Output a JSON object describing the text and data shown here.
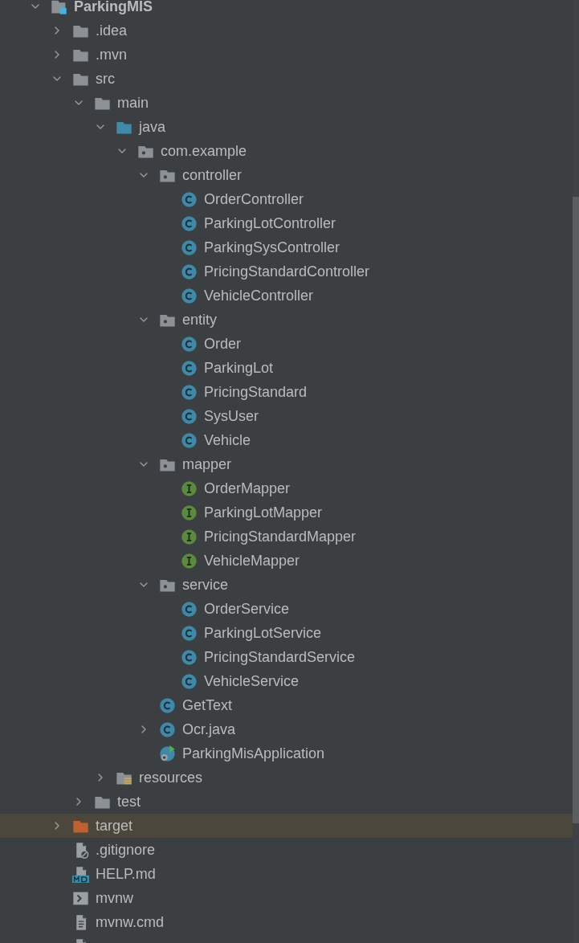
{
  "tree": [
    {
      "label": "ParkingMIS",
      "kind": "project",
      "expanded": true,
      "selected": false,
      "children": [
        {
          "label": ".idea",
          "kind": "folder",
          "expanded": false,
          "selected": false
        },
        {
          "label": ".mvn",
          "kind": "folder",
          "expanded": false,
          "selected": false
        },
        {
          "label": "src",
          "kind": "folder",
          "expanded": true,
          "selected": false,
          "children": [
            {
              "label": "main",
              "kind": "folder",
              "expanded": true,
              "selected": false,
              "children": [
                {
                  "label": "java",
                  "kind": "source-folder",
                  "expanded": true,
                  "selected": false,
                  "children": [
                    {
                      "label": "com.example",
                      "kind": "package",
                      "expanded": true,
                      "selected": false,
                      "children": [
                        {
                          "label": "controller",
                          "kind": "package",
                          "expanded": true,
                          "selected": false,
                          "children": [
                            {
                              "label": "OrderController",
                              "kind": "class",
                              "selected": false
                            },
                            {
                              "label": "ParkingLotController",
                              "kind": "class",
                              "selected": false
                            },
                            {
                              "label": "ParkingSysController",
                              "kind": "class",
                              "selected": false
                            },
                            {
                              "label": "PricingStandardController",
                              "kind": "class",
                              "selected": false
                            },
                            {
                              "label": "VehicleController",
                              "kind": "class",
                              "selected": false
                            }
                          ]
                        },
                        {
                          "label": "entity",
                          "kind": "package",
                          "expanded": true,
                          "selected": false,
                          "children": [
                            {
                              "label": "Order",
                              "kind": "class",
                              "selected": false
                            },
                            {
                              "label": "ParkingLot",
                              "kind": "class",
                              "selected": false
                            },
                            {
                              "label": "PricingStandard",
                              "kind": "class",
                              "selected": false
                            },
                            {
                              "label": "SysUser",
                              "kind": "class",
                              "selected": false
                            },
                            {
                              "label": "Vehicle",
                              "kind": "class",
                              "selected": false
                            }
                          ]
                        },
                        {
                          "label": "mapper",
                          "kind": "package",
                          "expanded": true,
                          "selected": false,
                          "children": [
                            {
                              "label": "OrderMapper",
                              "kind": "interface",
                              "selected": false
                            },
                            {
                              "label": "ParkingLotMapper",
                              "kind": "interface",
                              "selected": false
                            },
                            {
                              "label": "PricingStandardMapper",
                              "kind": "interface",
                              "selected": false
                            },
                            {
                              "label": "VehicleMapper",
                              "kind": "interface",
                              "selected": false
                            }
                          ]
                        },
                        {
                          "label": "service",
                          "kind": "package",
                          "expanded": true,
                          "selected": false,
                          "children": [
                            {
                              "label": "OrderService",
                              "kind": "class",
                              "selected": false
                            },
                            {
                              "label": "ParkingLotService",
                              "kind": "class",
                              "selected": false
                            },
                            {
                              "label": "PricingStandardService",
                              "kind": "class",
                              "selected": false
                            },
                            {
                              "label": "VehicleService",
                              "kind": "class",
                              "selected": false
                            }
                          ]
                        },
                        {
                          "label": "GetText",
                          "kind": "class",
                          "selected": false
                        },
                        {
                          "label": "Ocr.java",
                          "kind": "class",
                          "expanded": false,
                          "selected": false
                        },
                        {
                          "label": "ParkingMisApplication",
                          "kind": "app-class",
                          "selected": false
                        }
                      ]
                    }
                  ]
                },
                {
                  "label": "resources",
                  "kind": "resources-folder",
                  "expanded": false,
                  "selected": false
                }
              ]
            },
            {
              "label": "test",
              "kind": "folder",
              "expanded": false,
              "selected": false
            }
          ]
        },
        {
          "label": "target",
          "kind": "excluded-folder",
          "expanded": false,
          "selected": true
        },
        {
          "label": ".gitignore",
          "kind": "ignore-file",
          "selected": false
        },
        {
          "label": "HELP.md",
          "kind": "markdown-file",
          "selected": false
        },
        {
          "label": "mvnw",
          "kind": "script-file",
          "selected": false
        },
        {
          "label": "mvnw.cmd",
          "kind": "text-file",
          "selected": false
        },
        {
          "kind": "module-file",
          "selected": false
        }
      ]
    }
  ]
}
